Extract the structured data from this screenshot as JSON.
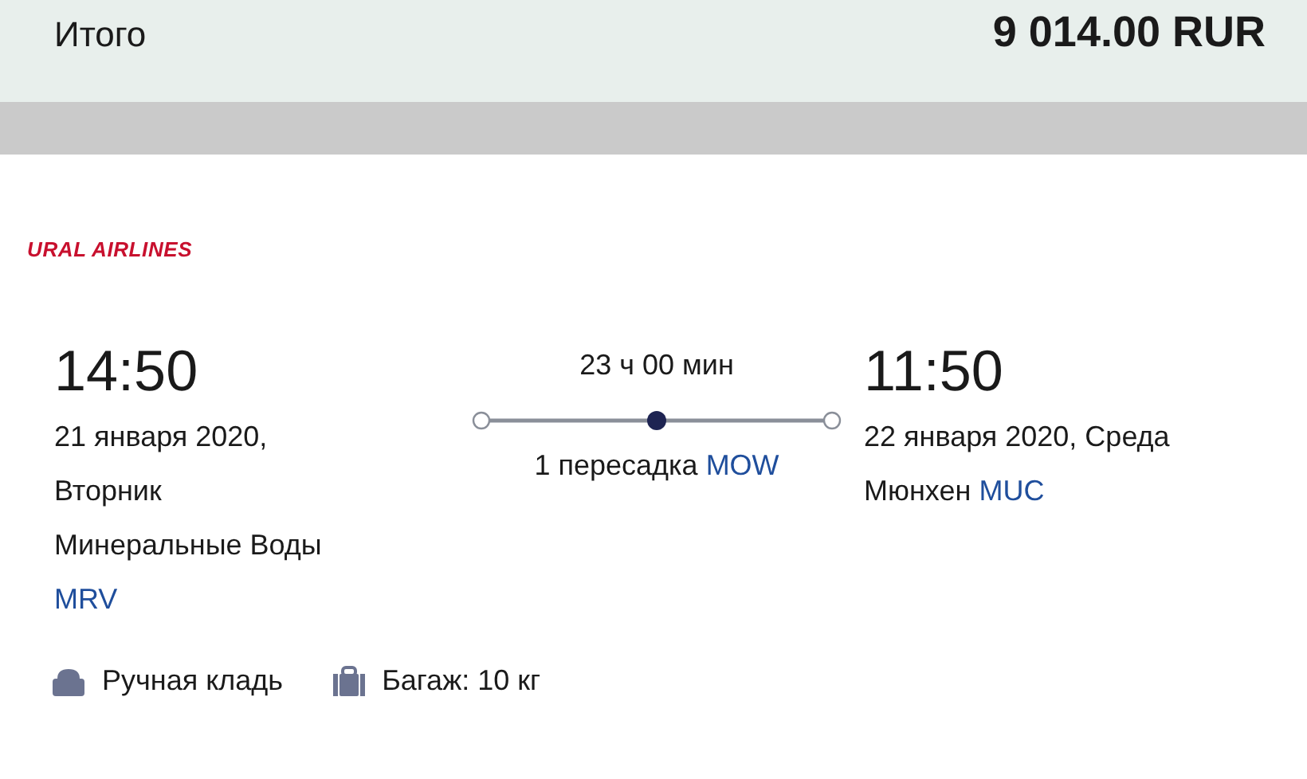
{
  "summary": {
    "label": "Итого",
    "total": "9 014.00 RUR"
  },
  "airline": {
    "logo_text": "URAL AIRLINES"
  },
  "departure": {
    "time": "14:50",
    "date_lines": [
      "21 января 2020,",
      "Вторник"
    ],
    "city": "Минеральные Воды",
    "code": "MRV"
  },
  "route": {
    "duration": "23 ч 00 мин",
    "stops_text": "1 пересадка",
    "stop_code": "MOW"
  },
  "arrival": {
    "time": "11:50",
    "date_lines": [
      "22 января 2020, Среда"
    ],
    "city": "Мюнхен",
    "code": "MUC"
  },
  "baggage": [
    {
      "kind": "hand",
      "label": "Ручная кладь"
    },
    {
      "kind": "checked",
      "label": "Багаж: 10 кг"
    }
  ]
}
